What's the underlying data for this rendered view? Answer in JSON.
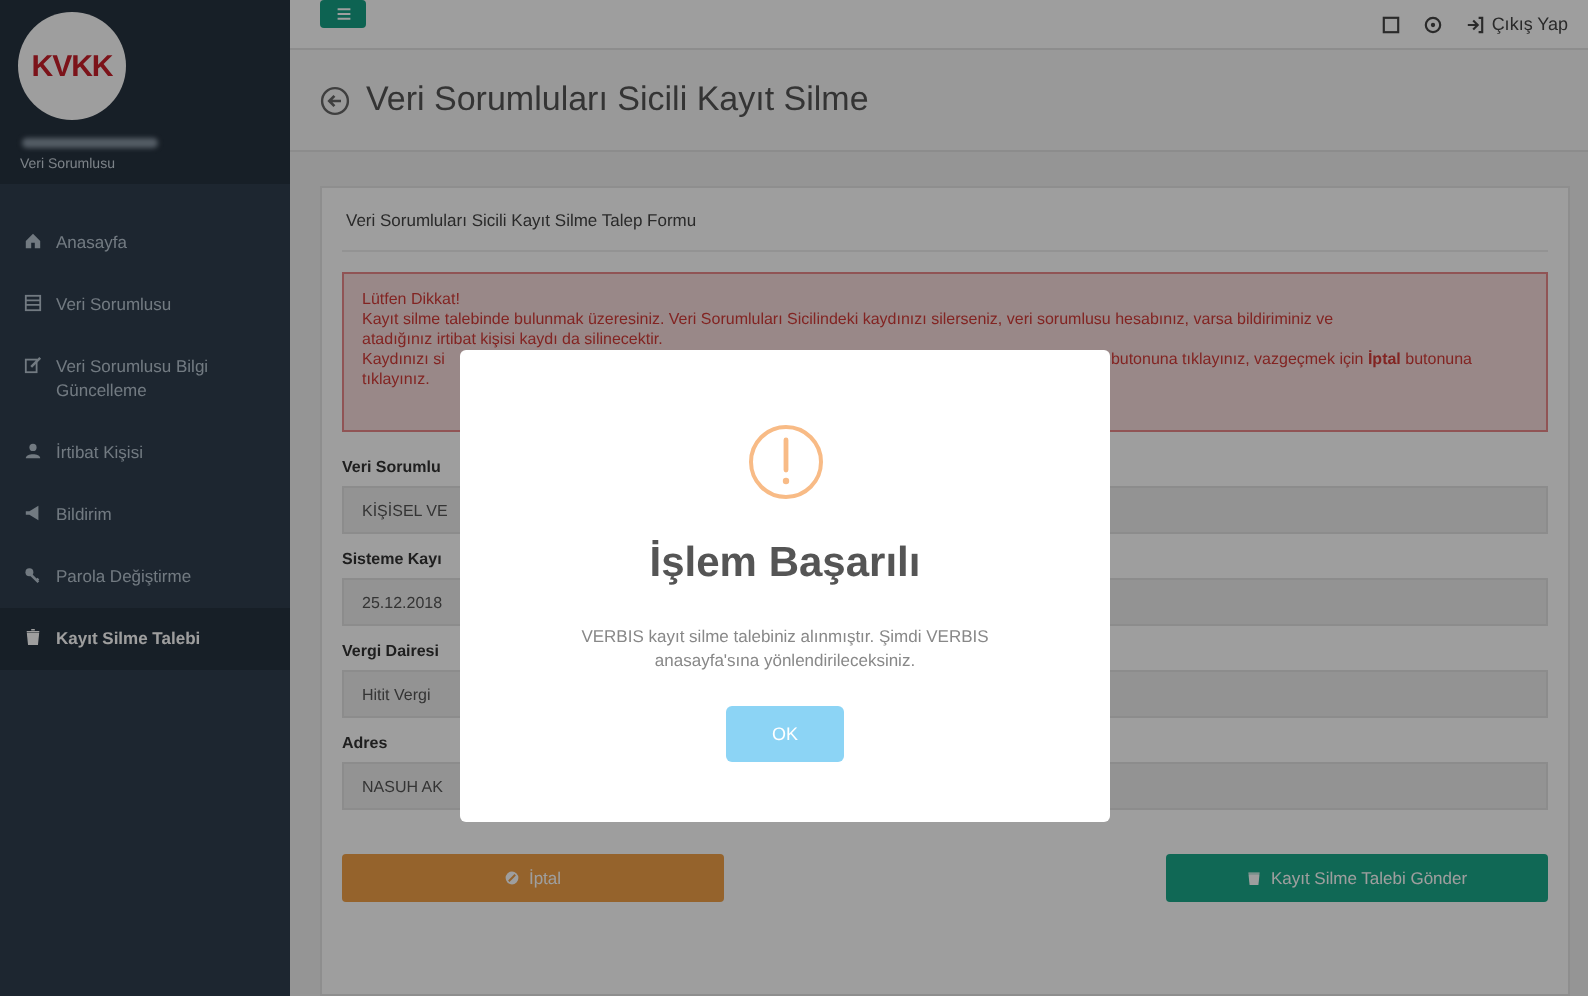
{
  "topbar": {
    "logout_link": "Çıkış Yap"
  },
  "sidebar": {
    "logo": "KVKK",
    "role": "Veri Sorumlusu",
    "items": [
      {
        "label": "Anasayfa",
        "selected": false
      },
      {
        "label": "Veri Sorumlusu",
        "selected": false
      },
      {
        "label": "Veri Sorumlusu Bilgi Güncelleme",
        "selected": false
      },
      {
        "label": "İrtibat Kişisi",
        "selected": false
      },
      {
        "label": "Bildirim",
        "selected": false
      },
      {
        "label": "Parola Değiştirme",
        "selected": false
      },
      {
        "label": "Kayıt Silme Talebi",
        "selected": true
      }
    ]
  },
  "page_title": "Veri Sorumluları Sicili Kayıt Silme",
  "form": {
    "title": "Veri Sorumluları Sicili Kayıt Silme Talep Formu",
    "alert": {
      "heading": "Lütfen Dikkat!",
      "lines": [
        [
          "Kayıt silme talebinde bulunmak üzeresiniz. Veri Sorumluları Sicilindeki kaydınızı silerseniz, veri sorumlusu hesabınız, varsa bildiriminiz ve"
        ],
        [
          "atadığınız irtibat kişisi kaydı da silinecektir."
        ],
        [
          "Kaydınızı si",
          "butonuna tıklayınız, vazgeçmek için **İptal** butonuna"
        ],
        [
          "tıklayınız."
        ]
      ]
    },
    "fields": [
      {
        "label": "Veri Sorumlu",
        "value": "KİŞİSEL VE"
      },
      {
        "label": "Sisteme Kayı",
        "value": "25.12.2018"
      },
      {
        "label": "Vergi Dairesi",
        "value": "Hitit Vergi"
      },
      {
        "label": "Adres",
        "value": "NASUH AK"
      }
    ],
    "buttons": [
      {
        "kind": "cancel",
        "label": "İptal"
      },
      {
        "kind": "submit",
        "label": "Kayıt Silme Talebi Gönder"
      }
    ]
  },
  "modal": {
    "title": "İşlem Başarılı",
    "message": "VERBIS kayıt silme talebiniz alınmıştır. Şimdi VERBIS anasayfa'sına yönlendirileceksiniz.",
    "button": "OK"
  }
}
